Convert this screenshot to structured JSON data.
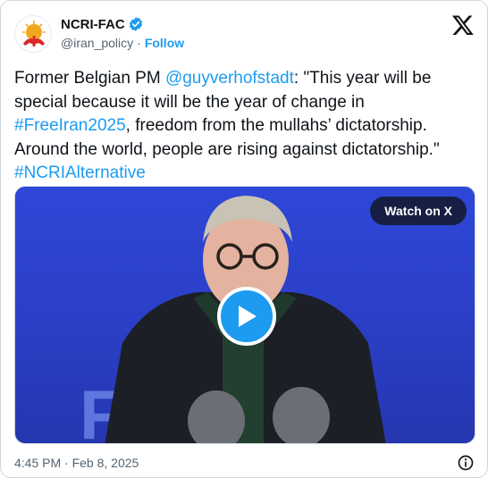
{
  "author": {
    "display_name": "NCRI-FAC",
    "handle": "@iran_policy",
    "separator": "·",
    "follow_label": "Follow",
    "verified": true,
    "avatar_icon": "lion-and-sun-logo-icon"
  },
  "tweet": {
    "text_1": "Former Belgian PM ",
    "mention": "@guyverhofstadt",
    "text_2": ": \"This year will be special because it will be the year of change in ",
    "hashtag_1": "#FreeIran2025",
    "text_3": ", freedom from the mullahs’ dictatorship. Around the world, people are rising against dictatorship.\" ",
    "hashtag_2": "#NCRIAlternative"
  },
  "media": {
    "watch_label": "Watch on X",
    "play_icon": "play-icon",
    "background_text": "FR      N"
  },
  "footer": {
    "timestamp": "4:45 PM · Feb 8, 2025",
    "info_icon": "info-icon"
  },
  "colors": {
    "link": "#1d9bf0",
    "text": "#0f1419",
    "muted": "#536471",
    "media_bg": "#2f47d8"
  }
}
